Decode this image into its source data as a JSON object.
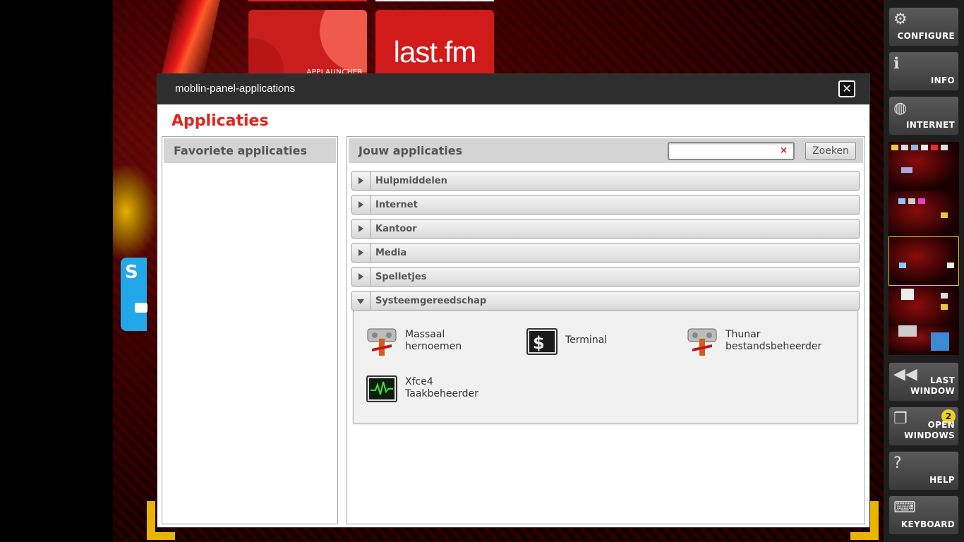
{
  "window": {
    "title": "moblin-panel-applications",
    "close_icon": "close-icon",
    "heading": "Applicaties"
  },
  "favorites": {
    "header": "Favoriete applicaties"
  },
  "apps": {
    "header": "Jouw applicaties",
    "search": {
      "value": "",
      "placeholder": "",
      "clear_icon": "×"
    },
    "search_button": "Zoeken",
    "categories": [
      {
        "label": "Hulpmiddelen",
        "expanded": false
      },
      {
        "label": "Internet",
        "expanded": false
      },
      {
        "label": "Kantoor",
        "expanded": false
      },
      {
        "label": "Media",
        "expanded": false
      },
      {
        "label": "Spelletjes",
        "expanded": false
      },
      {
        "label": "Systeemgereedschap",
        "expanded": true
      }
    ],
    "items": [
      {
        "name": "Massaal\nhernoemen",
        "icon": "rename-tool-icon"
      },
      {
        "name": "Terminal",
        "icon": "terminal-icon"
      },
      {
        "name": "Thunar\nbestandsbeheerder",
        "icon": "file-manager-icon"
      },
      {
        "name": "Xfce4\nTaakbeheerder",
        "icon": "task-manager-icon"
      }
    ]
  },
  "desktop": {
    "applauncher_label": "APPLAUNCHER",
    "lastfm_logo": "last.fm"
  },
  "sidebar": {
    "configure": "CONFIGURE",
    "info": "INFO",
    "internet": "INTERNET",
    "last_window": "LAST\nWINDOW",
    "open_windows": "OPEN\nWINDOWS",
    "open_windows_count": "2",
    "help": "HELP",
    "keyboard": "KEYBOARD"
  },
  "colors": {
    "accent_red": "#e1231c",
    "badge_yellow": "#f1d21b",
    "titlebar": "#2e2e2e"
  }
}
